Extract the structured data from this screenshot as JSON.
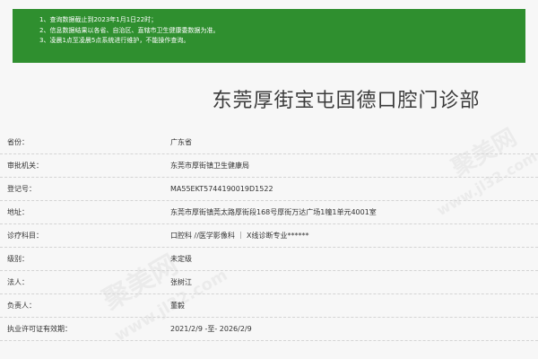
{
  "notice": {
    "lines": [
      "1、查询数据截止到2023年1月1日22时；",
      "2、信息数据结果以各省、自治区、直辖市卫生健康委数据为准。",
      "3、凌晨1点至凌晨5点系统进行维护，不能操作查询。"
    ],
    "bg_color": "#2f8f2f"
  },
  "title": "东莞厚街宝屯固德口腔门诊部",
  "rows": [
    {
      "label": "省份：",
      "value": "广东省"
    },
    {
      "label": "审批机关：",
      "value": "东莞市厚街镇卫生健康局"
    },
    {
      "label": "登记号：",
      "value": "MA55EKT5744190019D1522"
    },
    {
      "label": "地址：",
      "value": "东莞市厚街镇莞太路厚街段168号厚街万达广场1幢1单元4001室"
    },
    {
      "label": "诊疗科目：",
      "value": "口腔科 //医学影像科 ｜ X线诊断专业******"
    },
    {
      "label": "级别：",
      "value": "未定级"
    },
    {
      "label": "法人：",
      "value": "张树江"
    },
    {
      "label": "负责人：",
      "value": "董毅"
    },
    {
      "label": "执业许可证有效期：",
      "value": "2021/2/9 -至- 2026/2/9"
    }
  ],
  "watermark": {
    "text_cn": "聚美网",
    "text_url": "www.jl32.com"
  }
}
